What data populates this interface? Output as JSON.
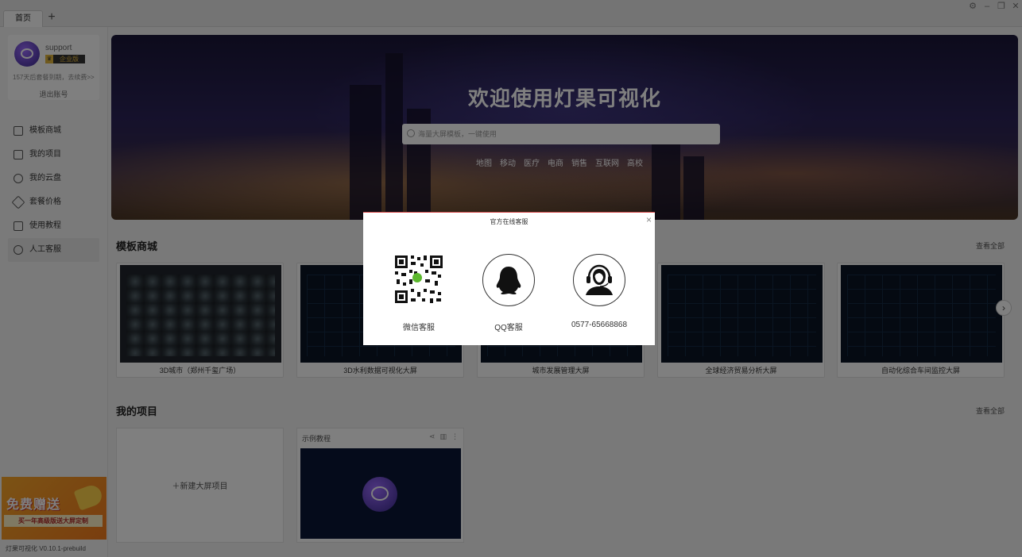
{
  "titlebar": {
    "tab_home": "首页",
    "tab_add": "+",
    "controls": [
      "gear-icon",
      "minimize-icon",
      "restore-icon",
      "close-icon"
    ]
  },
  "sidebar": {
    "user": {
      "name": "support",
      "badge_tier": "企业版",
      "renew_text": "157天后套餐到期，去续费>>",
      "logout": "退出账号"
    },
    "nav": [
      {
        "label": "模板商城",
        "icon": "store-icon"
      },
      {
        "label": "我的项目",
        "icon": "chart-icon"
      },
      {
        "label": "我的云盘",
        "icon": "cloud-icon"
      },
      {
        "label": "套餐价格",
        "icon": "tag-icon"
      },
      {
        "label": "使用教程",
        "icon": "book-icon"
      },
      {
        "label": "人工客服",
        "icon": "user-icon"
      }
    ],
    "promo": {
      "title": "免费赠送",
      "subtitle": "买一年高级版送大屏定制"
    },
    "version": "灯果可视化 V0.10.1-prebuild"
  },
  "banner": {
    "title": "欢迎使用灯果可视化",
    "search_placeholder": "海量大屏模板，一键使用",
    "tags": [
      "地图",
      "移动",
      "医疗",
      "电商",
      "销售",
      "互联网",
      "高校"
    ]
  },
  "templates": {
    "title": "模板商城",
    "view_all": "查看全部",
    "cards": [
      {
        "label": "3D城市（郑州千玺广场）"
      },
      {
        "label": "3D水利数据可视化大屏"
      },
      {
        "label": "城市发展管理大屏"
      },
      {
        "label": "全球经济贸易分析大屏"
      },
      {
        "label": "自动化综合车间监控大屏"
      }
    ]
  },
  "projects": {
    "title": "我的项目",
    "view_all": "查看全部",
    "new_label": "＋新建大屏项目",
    "items": [
      {
        "name": "示例教程"
      }
    ]
  },
  "modal": {
    "title": "官方在线客服",
    "close": "×",
    "services": [
      {
        "label": "微信客服",
        "icon": "qr-code-icon"
      },
      {
        "label": "QQ客服",
        "icon": "qq-penguin-icon"
      },
      {
        "label": "0577-65668868",
        "icon": "headset-agent-icon"
      }
    ]
  }
}
